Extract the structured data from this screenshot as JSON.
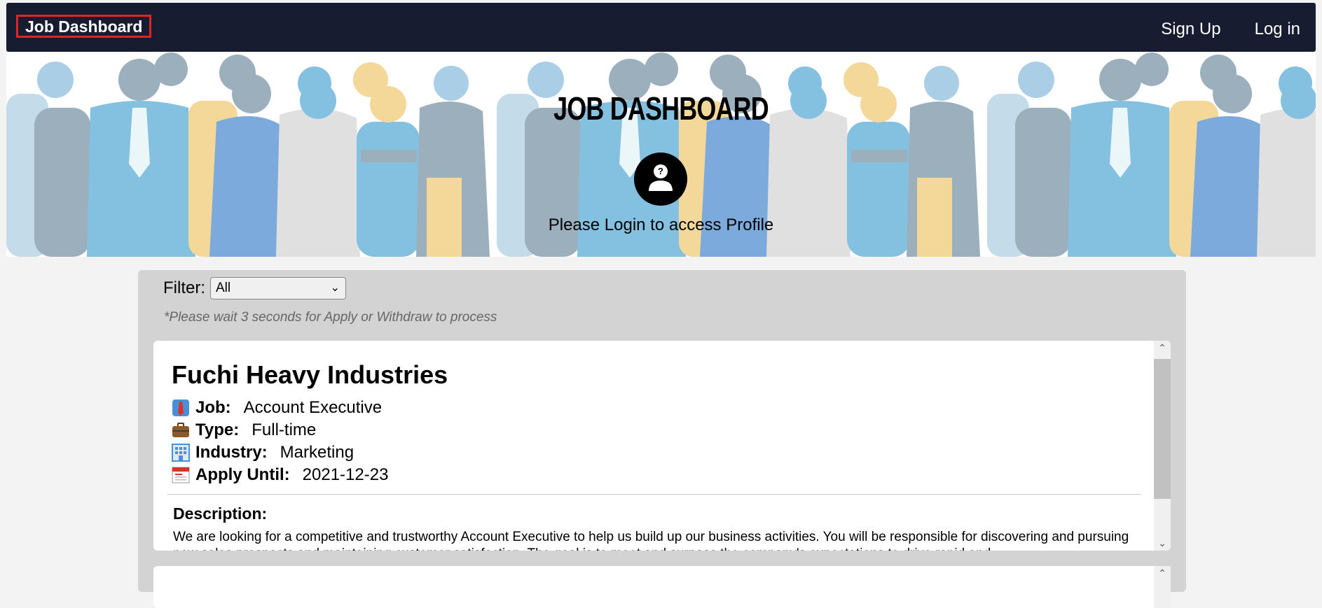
{
  "navbar": {
    "brand": "Job Dashboard",
    "links": [
      "Sign Up",
      "Log in"
    ]
  },
  "hero": {
    "title": "JOB DASHBOARD",
    "avatar_icon": "user-question-icon",
    "message": "Please Login to access Profile"
  },
  "filter": {
    "label": "Filter:",
    "selected": "All",
    "note": "*Please wait 3 seconds for Apply or Withdraw to process"
  },
  "jobs": [
    {
      "company": "Fuchi Heavy Industries",
      "fields": [
        {
          "icon": "necktie-icon",
          "label": "Job:",
          "value": "Account Executive"
        },
        {
          "icon": "briefcase-icon",
          "label": "Type:",
          "value": "Full-time"
        },
        {
          "icon": "office-building-icon",
          "label": "Industry:",
          "value": "Marketing"
        },
        {
          "icon": "calendar-icon",
          "label": "Apply Until:",
          "value": "2021-12-23"
        }
      ],
      "description_label": "Description:",
      "description": "We are looking for a competitive and trustworthy Account Executive to help us build up our business activities. You will be responsible for discovering and pursuing new sales prospects and maintaining customer satisfaction. The goal is to meet and surpass the company's expectations to drive rapid and"
    }
  ],
  "colors": {
    "navbar_bg": "#171c31",
    "brand_outline": "#e02424",
    "panel_bg": "#d3d3d3"
  }
}
